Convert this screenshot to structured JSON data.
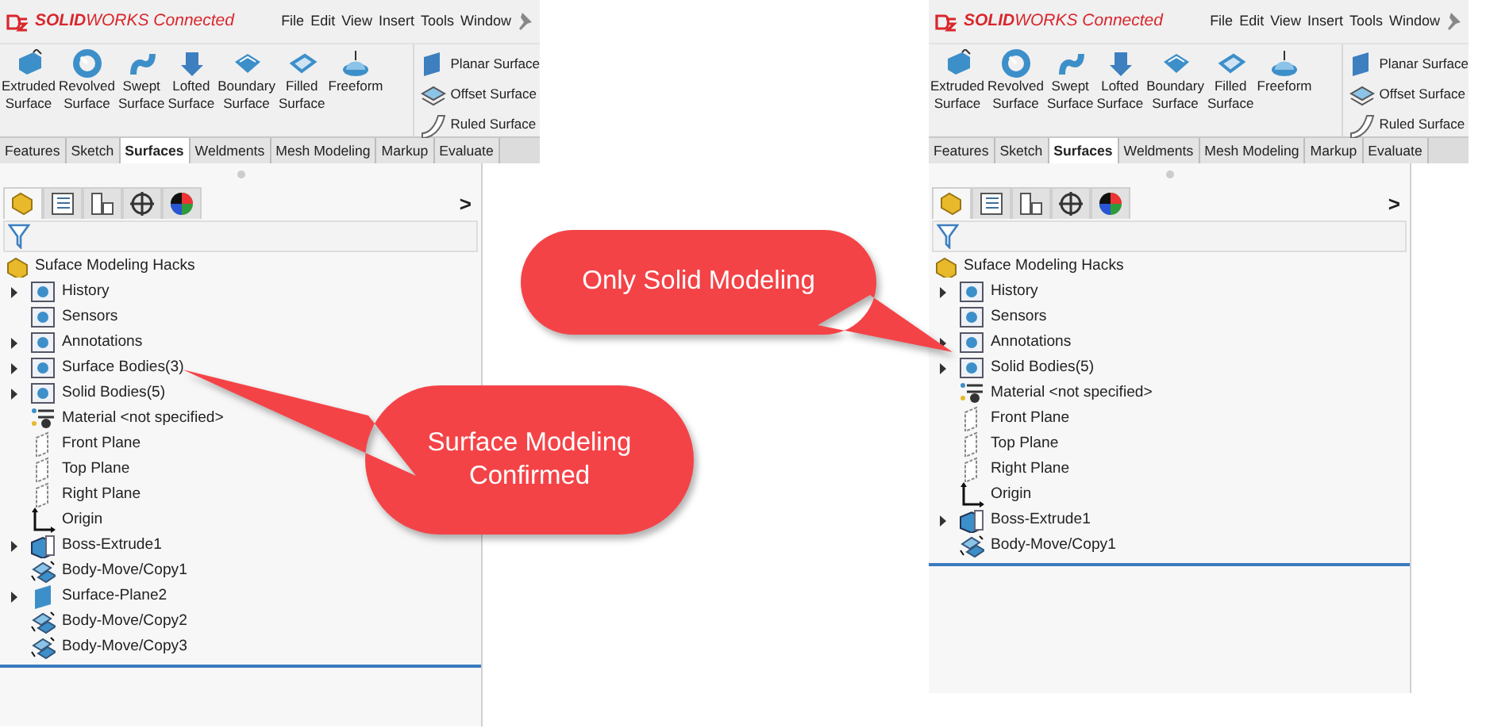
{
  "panels": [
    {
      "logo": "**SOLID**WORKS Connected",
      "menu": [
        "File",
        "Edit",
        "View",
        "Insert",
        "Tools",
        "Window"
      ],
      "tools": [
        {
          "label": "Extruded Surface"
        },
        {
          "label": "Revolved Surface"
        },
        {
          "label": "Swept Surface"
        },
        {
          "label": "Lofted Surface"
        },
        {
          "label": "Boundary Surface"
        },
        {
          "label": "Filled Surface"
        },
        {
          "label": "Freeform"
        }
      ],
      "side_tools": [
        "Planar Surface",
        "Offset Surface",
        "Ruled Surface"
      ],
      "tabs": [
        {
          "label": "Features",
          "selected": false
        },
        {
          "label": "Sketch",
          "selected": false
        },
        {
          "label": "Surfaces",
          "selected": true
        },
        {
          "label": "Weldments",
          "selected": false
        },
        {
          "label": "Mesh Modeling",
          "selected": false
        },
        {
          "label": "Markup",
          "selected": false
        },
        {
          "label": "Evaluate",
          "selected": false
        }
      ],
      "icon_tabs": [
        {
          "kind": "part",
          "selected": true
        },
        {
          "kind": "list",
          "selected": false
        },
        {
          "kind": "config",
          "selected": false
        },
        {
          "kind": "target",
          "selected": false
        },
        {
          "kind": "ball",
          "selected": false
        }
      ],
      "nav_arrow": ">",
      "tree": {
        "root": "Suface Modeling Hacks",
        "items": [
          {
            "label": "History",
            "kind": "folder",
            "expandable": true
          },
          {
            "label": "Sensors",
            "kind": "folder",
            "expandable": false
          },
          {
            "label": "Annotations",
            "kind": "folder",
            "expandable": true
          },
          {
            "label": "Surface Bodies(3)",
            "kind": "folder",
            "expandable": true
          },
          {
            "label": "Solid Bodies(5)",
            "kind": "folder",
            "expandable": true
          },
          {
            "label": "Material <not specified>",
            "kind": "material",
            "expandable": false
          },
          {
            "label": "Front Plane",
            "kind": "plane",
            "expandable": false
          },
          {
            "label": "Top Plane",
            "kind": "plane",
            "expandable": false
          },
          {
            "label": "Right Plane",
            "kind": "plane",
            "expandable": false
          },
          {
            "label": "Origin",
            "kind": "origin",
            "expandable": false
          },
          {
            "label": "Boss-Extrude1",
            "kind": "extrude",
            "expandable": true
          },
          {
            "label": "Body-Move/Copy1",
            "kind": "move",
            "expandable": false
          },
          {
            "label": "Surface-Plane2",
            "kind": "surface",
            "expandable": true
          },
          {
            "label": "Body-Move/Copy2",
            "kind": "move",
            "expandable": false
          },
          {
            "label": "Body-Move/Copy3",
            "kind": "move",
            "expandable": false
          }
        ]
      }
    },
    {
      "logo": "**SOLID**WORKS Connected",
      "menu": [
        "File",
        "Edit",
        "View",
        "Insert",
        "Tools",
        "Window"
      ],
      "tools": [
        {
          "label": "Extruded Surface"
        },
        {
          "label": "Revolved Surface"
        },
        {
          "label": "Swept Surface"
        },
        {
          "label": "Lofted Surface"
        },
        {
          "label": "Boundary Surface"
        },
        {
          "label": "Filled Surface"
        },
        {
          "label": "Freeform"
        }
      ],
      "side_tools": [
        "Planar Surface",
        "Offset Surface",
        "Ruled Surface"
      ],
      "tabs": [
        {
          "label": "Features",
          "selected": false
        },
        {
          "label": "Sketch",
          "selected": false
        },
        {
          "label": "Surfaces",
          "selected": true
        },
        {
          "label": "Weldments",
          "selected": false
        },
        {
          "label": "Mesh Modeling",
          "selected": false
        },
        {
          "label": "Markup",
          "selected": false
        },
        {
          "label": "Evaluate",
          "selected": false
        }
      ],
      "icon_tabs": [
        {
          "kind": "part",
          "selected": true
        },
        {
          "kind": "list",
          "selected": false
        },
        {
          "kind": "config",
          "selected": false
        },
        {
          "kind": "target",
          "selected": false
        },
        {
          "kind": "ball",
          "selected": false
        }
      ],
      "nav_arrow": ">",
      "tree": {
        "root": "Suface Modeling Hacks",
        "items": [
          {
            "label": "History",
            "kind": "folder",
            "expandable": true
          },
          {
            "label": "Sensors",
            "kind": "folder",
            "expandable": false
          },
          {
            "label": "Annotations",
            "kind": "folder",
            "expandable": true
          },
          {
            "label": "Solid Bodies(5)",
            "kind": "folder",
            "expandable": true
          },
          {
            "label": "Material <not specified>",
            "kind": "material",
            "expandable": false
          },
          {
            "label": "Front Plane",
            "kind": "plane",
            "expandable": false
          },
          {
            "label": "Top Plane",
            "kind": "plane",
            "expandable": false
          },
          {
            "label": "Right Plane",
            "kind": "plane",
            "expandable": false
          },
          {
            "label": "Origin",
            "kind": "origin",
            "expandable": false
          },
          {
            "label": "Boss-Extrude1",
            "kind": "extrude",
            "expandable": true
          },
          {
            "label": "Body-Move/Copy1",
            "kind": "move",
            "expandable": false
          }
        ]
      }
    }
  ],
  "callouts": [
    {
      "text": "Surface Modeling Confirmed"
    },
    {
      "text": "Only Solid Modeling"
    }
  ]
}
